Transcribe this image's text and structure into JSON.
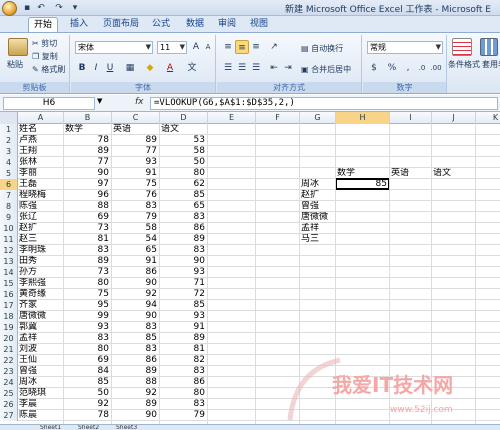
{
  "title_bar": {
    "title": "新建 Microsoft Office Excel 工作表 - Microsoft E",
    "quick_access": [
      "save-icon",
      "undo-icon",
      "redo-icon"
    ]
  },
  "tabs": [
    "开始",
    "插入",
    "页面布局",
    "公式",
    "数据",
    "审阅",
    "视图"
  ],
  "ribbon": {
    "clipboard": {
      "paste": "粘贴",
      "cut": "剪切",
      "copy": "复制",
      "format_painter": "格式刷",
      "label": "剪贴板"
    },
    "font": {
      "font_name": "宋体",
      "font_size": "11",
      "label": "字体"
    },
    "alignment": {
      "wrap_text": "自动换行",
      "merge_center": "合并后居中",
      "label": "对齐方式"
    },
    "number": {
      "format": "常规",
      "label": "数字"
    },
    "styles": {
      "conditional": "条件格式",
      "table": "套用表格式"
    }
  },
  "formula_bar": {
    "name_box": "H6",
    "formula": "=VLOOKUP(G6,$A$1:$D$35,2,)"
  },
  "columns": [
    "A",
    "B",
    "C",
    "D",
    "E",
    "F",
    "G",
    "H",
    "I",
    "J",
    "K"
  ],
  "rows": [
    {
      "n": "1",
      "a": "姓名",
      "b": "数学",
      "c": "英语",
      "d": "语文"
    },
    {
      "n": "2",
      "a": "卢燕",
      "b": "78",
      "c": "89",
      "d": "53"
    },
    {
      "n": "3",
      "a": "王翔",
      "b": "89",
      "c": "77",
      "d": "58"
    },
    {
      "n": "4",
      "a": "张林",
      "b": "77",
      "c": "93",
      "d": "50"
    },
    {
      "n": "5",
      "a": "李丽",
      "b": "90",
      "c": "91",
      "d": "80",
      "h": "数学",
      "i": "英语",
      "j": "语文"
    },
    {
      "n": "6",
      "a": "王磊",
      "b": "97",
      "c": "75",
      "d": "62",
      "g": "周冰",
      "h": "85"
    },
    {
      "n": "7",
      "a": "程晓梅",
      "b": "96",
      "c": "76",
      "d": "85",
      "g": "赵扩"
    },
    {
      "n": "8",
      "a": "陈强",
      "b": "88",
      "c": "83",
      "d": "65",
      "g": "曾强"
    },
    {
      "n": "9",
      "a": "张辽",
      "b": "69",
      "c": "79",
      "d": "83",
      "g": "唐微微"
    },
    {
      "n": "10",
      "a": "赵扩",
      "b": "73",
      "c": "58",
      "d": "86",
      "g": "孟祥"
    },
    {
      "n": "11",
      "a": "赵三",
      "b": "81",
      "c": "54",
      "d": "89",
      "g": "马三"
    },
    {
      "n": "12",
      "a": "李明珠",
      "b": "83",
      "c": "65",
      "d": "83"
    },
    {
      "n": "13",
      "a": "田秀",
      "b": "89",
      "c": "91",
      "d": "90"
    },
    {
      "n": "14",
      "a": "孙方",
      "b": "73",
      "c": "86",
      "d": "93"
    },
    {
      "n": "15",
      "a": "李熙强",
      "b": "80",
      "c": "90",
      "d": "71"
    },
    {
      "n": "16",
      "a": "黄奇缘",
      "b": "75",
      "c": "92",
      "d": "72"
    },
    {
      "n": "17",
      "a": "齐家",
      "b": "95",
      "c": "94",
      "d": "85"
    },
    {
      "n": "18",
      "a": "唐微微",
      "b": "99",
      "c": "90",
      "d": "93"
    },
    {
      "n": "19",
      "a": "郭冀",
      "b": "93",
      "c": "83",
      "d": "91"
    },
    {
      "n": "20",
      "a": "孟祥",
      "b": "83",
      "c": "85",
      "d": "89"
    },
    {
      "n": "21",
      "a": "刘波",
      "b": "80",
      "c": "83",
      "d": "81"
    },
    {
      "n": "22",
      "a": "王仙",
      "b": "69",
      "c": "86",
      "d": "82"
    },
    {
      "n": "23",
      "a": "曾强",
      "b": "84",
      "c": "89",
      "d": "83"
    },
    {
      "n": "24",
      "a": "周冰",
      "b": "85",
      "c": "88",
      "d": "86"
    },
    {
      "n": "25",
      "a": "范晓琪",
      "b": "50",
      "c": "92",
      "d": "80"
    },
    {
      "n": "26",
      "a": "李晨",
      "b": "92",
      "c": "89",
      "d": "83"
    },
    {
      "n": "27",
      "a": "陈晨",
      "b": "78",
      "c": "90",
      "d": "79"
    }
  ],
  "sheet_tabs": [
    "Sheet1",
    "Sheet2",
    "Sheet3"
  ],
  "watermark": {
    "text": "我爱IT技术网",
    "url": "www.52ij.com"
  },
  "colors": {
    "selection": "#f8d488",
    "ribbon": "#dbe6f4",
    "watermark": "#f4a7a7"
  }
}
